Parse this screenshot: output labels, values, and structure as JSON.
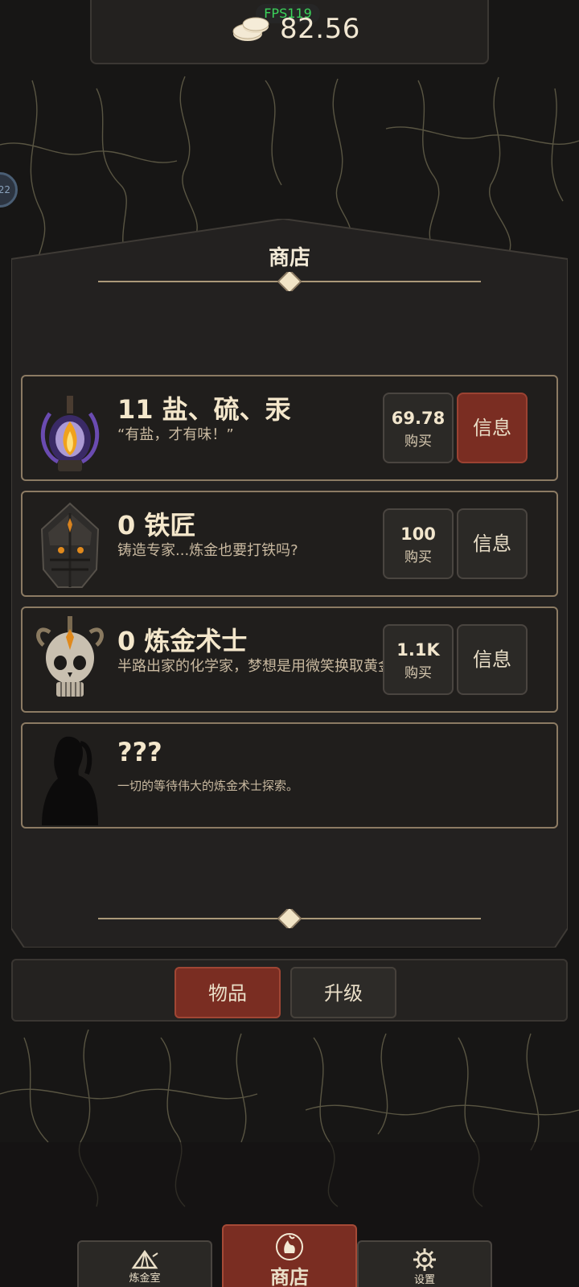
{
  "topbar": {
    "fps": "FPS119",
    "currency": "82.56",
    "currency_icon": "coins-icon"
  },
  "side_badge": "22",
  "shop": {
    "title": "商店",
    "items": [
      {
        "title": "11 盐、硫、汞",
        "desc": "“有盐，才有味！”",
        "price": "69.78",
        "buy_label": "购买",
        "info_label": "信息",
        "portrait": "flask-flame-portrait"
      },
      {
        "title": "0 铁匠",
        "desc": "铸造专家...炼金也要打铁吗?",
        "price": "100",
        "buy_label": "购买",
        "info_label": "信息",
        "portrait": "helmet-portrait"
      },
      {
        "title": "0 炼金术士",
        "desc": "半路出家的化学家，梦想是用微笑换取黄金",
        "price": "1.1K",
        "buy_label": "购买",
        "info_label": "信息",
        "portrait": "skull-portrait"
      },
      {
        "title": "???",
        "desc": "一切的等待伟大的炼金术士探索。",
        "portrait": "silhouette-portrait"
      }
    ]
  },
  "tabs": {
    "items": "物品",
    "upgrades": "升级"
  },
  "nav": {
    "lab": "炼金室",
    "shop": "商店",
    "settings": "设置"
  },
  "colors": {
    "accent_red": "#7a2d22",
    "panel_bg": "#232120",
    "border_gold": "#8c7b63",
    "text_cream": "#f4e7cb",
    "fps_green": "#3bd35a"
  }
}
